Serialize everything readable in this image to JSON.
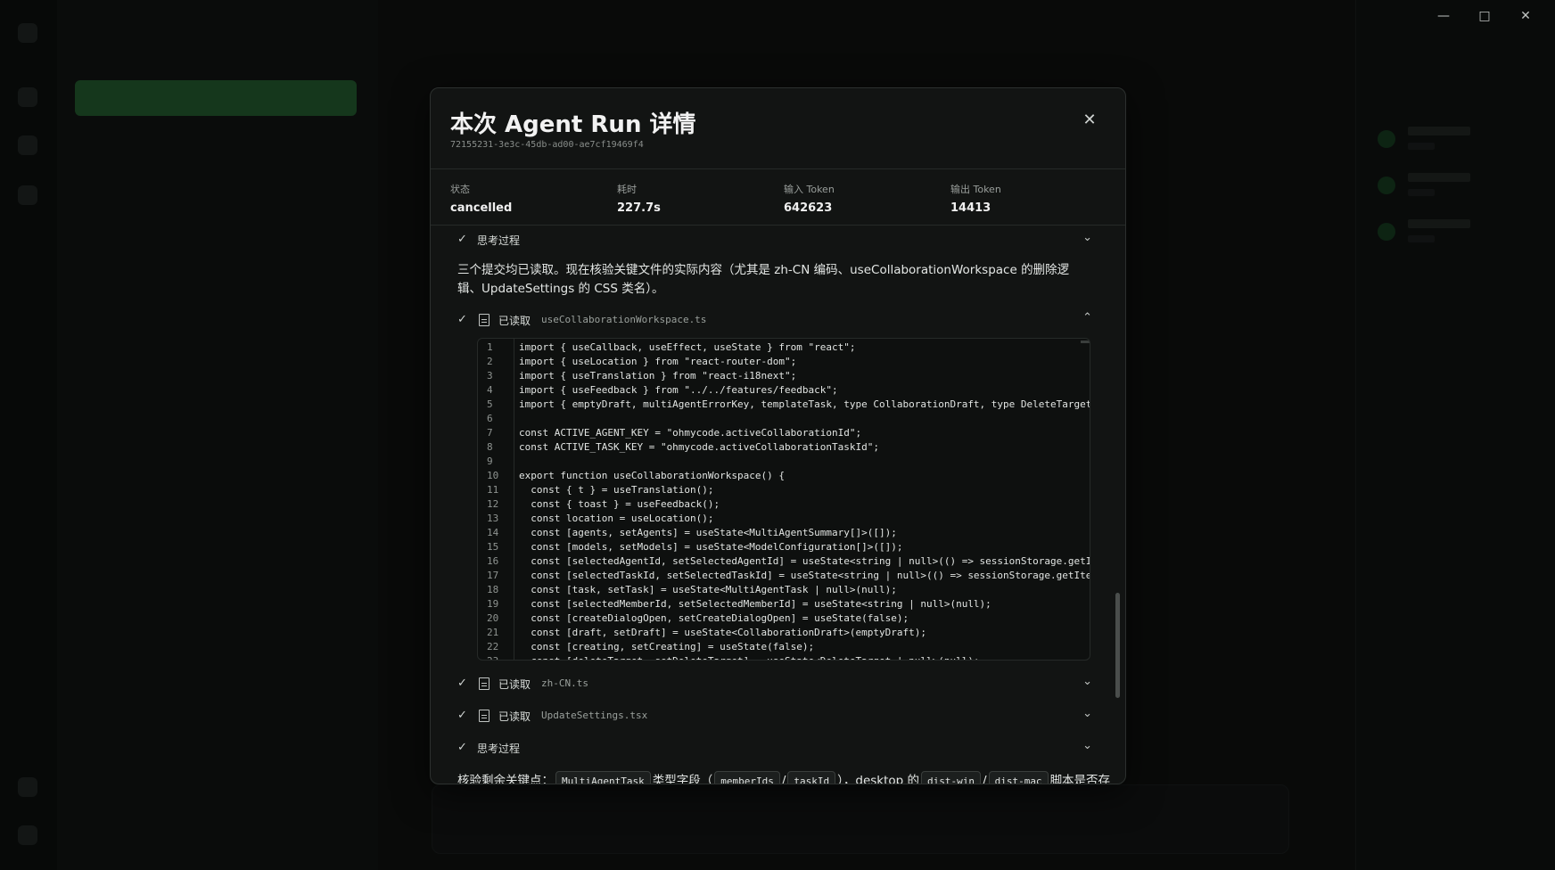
{
  "window_controls": [
    "—",
    "□",
    "✕"
  ],
  "modal": {
    "title": "本次 Agent Run 详情",
    "run_id": "72155231-3e3c-45db-ad00-ae7cf19469f4",
    "close_icon": "close-icon"
  },
  "stats": [
    {
      "label": "状态",
      "value": "cancelled"
    },
    {
      "label": "耗时",
      "value": "227.7s"
    },
    {
      "label": "输入 Token",
      "value": "642623"
    },
    {
      "label": "输出 Token",
      "value": "14413"
    }
  ],
  "steps": {
    "thinking1": {
      "label": "思考过程"
    },
    "paragraph": "三个提交均已读取。现在核验关键文件的实际内容（尤其是 zh-CN 编码、useCollaborationWorkspace 的删除逻辑、UpdateSettings 的 CSS 类名）。",
    "read1": {
      "label": "已读取",
      "file": "useCollaborationWorkspace.ts"
    },
    "read2": {
      "label": "已读取",
      "file": "zh-CN.ts"
    },
    "read3": {
      "label": "已读取",
      "file": "UpdateSettings.tsx"
    },
    "thinking2": {
      "label": "思考过程"
    },
    "partial_text": "核验剩余关键点：",
    "partial_code1": "MultiAgentTask",
    "partial_text2": "类型字段",
    "partial_code2": "memberIds",
    "partial_code3": "taskId",
    "partial_text3": "，desktop 的",
    "partial_code4": "dist-win",
    "partial_code5": "dist-mac",
    "partial_text4": "脚本是否存"
  },
  "code_lines": [
    {
      "n": "1",
      "t": "import { useCallback, useEffect, useState } from \"react\";"
    },
    {
      "n": "2",
      "t": "import { useLocation } from \"react-router-dom\";"
    },
    {
      "n": "3",
      "t": "import { useTranslation } from \"react-i18next\";"
    },
    {
      "n": "4",
      "t": "import { useFeedback } from \"../../features/feedback\";"
    },
    {
      "n": "5",
      "t": "import { emptyDraft, multiAgentErrorKey, templateTask, type CollaborationDraft, type DeleteTarget"
    },
    {
      "n": "6",
      "t": ""
    },
    {
      "n": "7",
      "t": "const ACTIVE_AGENT_KEY = \"ohmycode.activeCollaborationId\";"
    },
    {
      "n": "8",
      "t": "const ACTIVE_TASK_KEY = \"ohmycode.activeCollaborationTaskId\";"
    },
    {
      "n": "9",
      "t": ""
    },
    {
      "n": "10",
      "t": "export function useCollaborationWorkspace() {"
    },
    {
      "n": "11",
      "t": "  const { t } = useTranslation();"
    },
    {
      "n": "12",
      "t": "  const { toast } = useFeedback();"
    },
    {
      "n": "13",
      "t": "  const location = useLocation();"
    },
    {
      "n": "14",
      "t": "  const [agents, setAgents] = useState<MultiAgentSummary[]>([]);"
    },
    {
      "n": "15",
      "t": "  const [models, setModels] = useState<ModelConfiguration[]>([]);"
    },
    {
      "n": "16",
      "t": "  const [selectedAgentId, setSelectedAgentId] = useState<string | null>(() => sessionStorage.getI"
    },
    {
      "n": "17",
      "t": "  const [selectedTaskId, setSelectedTaskId] = useState<string | null>(() => sessionStorage.getIte"
    },
    {
      "n": "18",
      "t": "  const [task, setTask] = useState<MultiAgentTask | null>(null);"
    },
    {
      "n": "19",
      "t": "  const [selectedMemberId, setSelectedMemberId] = useState<string | null>(null);"
    },
    {
      "n": "20",
      "t": "  const [createDialogOpen, setCreateDialogOpen] = useState(false);"
    },
    {
      "n": "21",
      "t": "  const [draft, setDraft] = useState<CollaborationDraft>(emptyDraft);"
    },
    {
      "n": "22",
      "t": "  const [creating, setCreating] = useState(false);"
    },
    {
      "n": "23",
      "t": "  const [deleteTarget, setDeleteTarget] = useState<DeleteTarget | null>(null);"
    }
  ],
  "colors": {
    "accent": "#2b7a3a",
    "modal_bg": "#121413",
    "border": "#2c302e"
  }
}
